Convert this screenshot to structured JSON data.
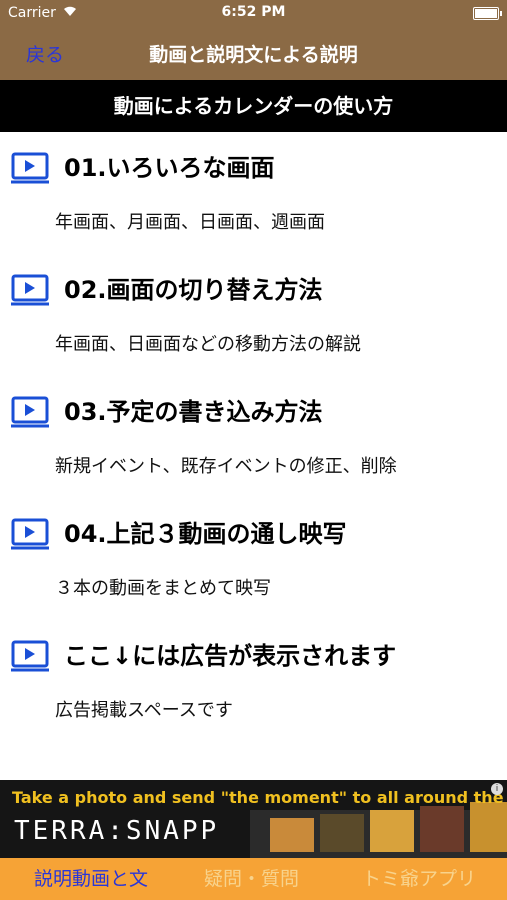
{
  "status_bar": {
    "carrier": "Carrier",
    "time": "6:52 PM"
  },
  "nav": {
    "back_label": "戻る",
    "title": "動画と説明文による説明"
  },
  "section_header": "動画によるカレンダーの使い方",
  "rows": [
    {
      "title": "01.いろいろな画面",
      "desc": "年画面、月画面、日画面、週画面"
    },
    {
      "title": "02.画面の切り替え方法",
      "desc": "年画面、日画面などの移動方法の解説"
    },
    {
      "title": "03.予定の書き込み方法",
      "desc": "新規イベント、既存イベントの修正、削除"
    },
    {
      "title": "04.上記３動画の通し映写",
      "desc": "３本の動画をまとめて映写"
    },
    {
      "title": "ここ↓には広告が表示されます",
      "desc": "広告掲載スペースです"
    }
  ],
  "ad": {
    "tagline": "Take a photo and send  \"the moment\" to all around the world!",
    "brand": "TERRA:SNAPP",
    "info": "i"
  },
  "tabs": [
    {
      "label": "説明動画と文",
      "active": true
    },
    {
      "label": "疑問・質問",
      "active": false
    },
    {
      "label": "トミ爺アプリ",
      "active": false
    }
  ],
  "colors": {
    "nav_bg": "#8b6a45",
    "back_link": "#2a36d8",
    "icon_blue": "#1a4fd6",
    "tab_bg": "#f6a336",
    "tab_active": "#2a36d8",
    "tab_inactive": "#f8d38c",
    "ad_text": "#f0c020"
  }
}
